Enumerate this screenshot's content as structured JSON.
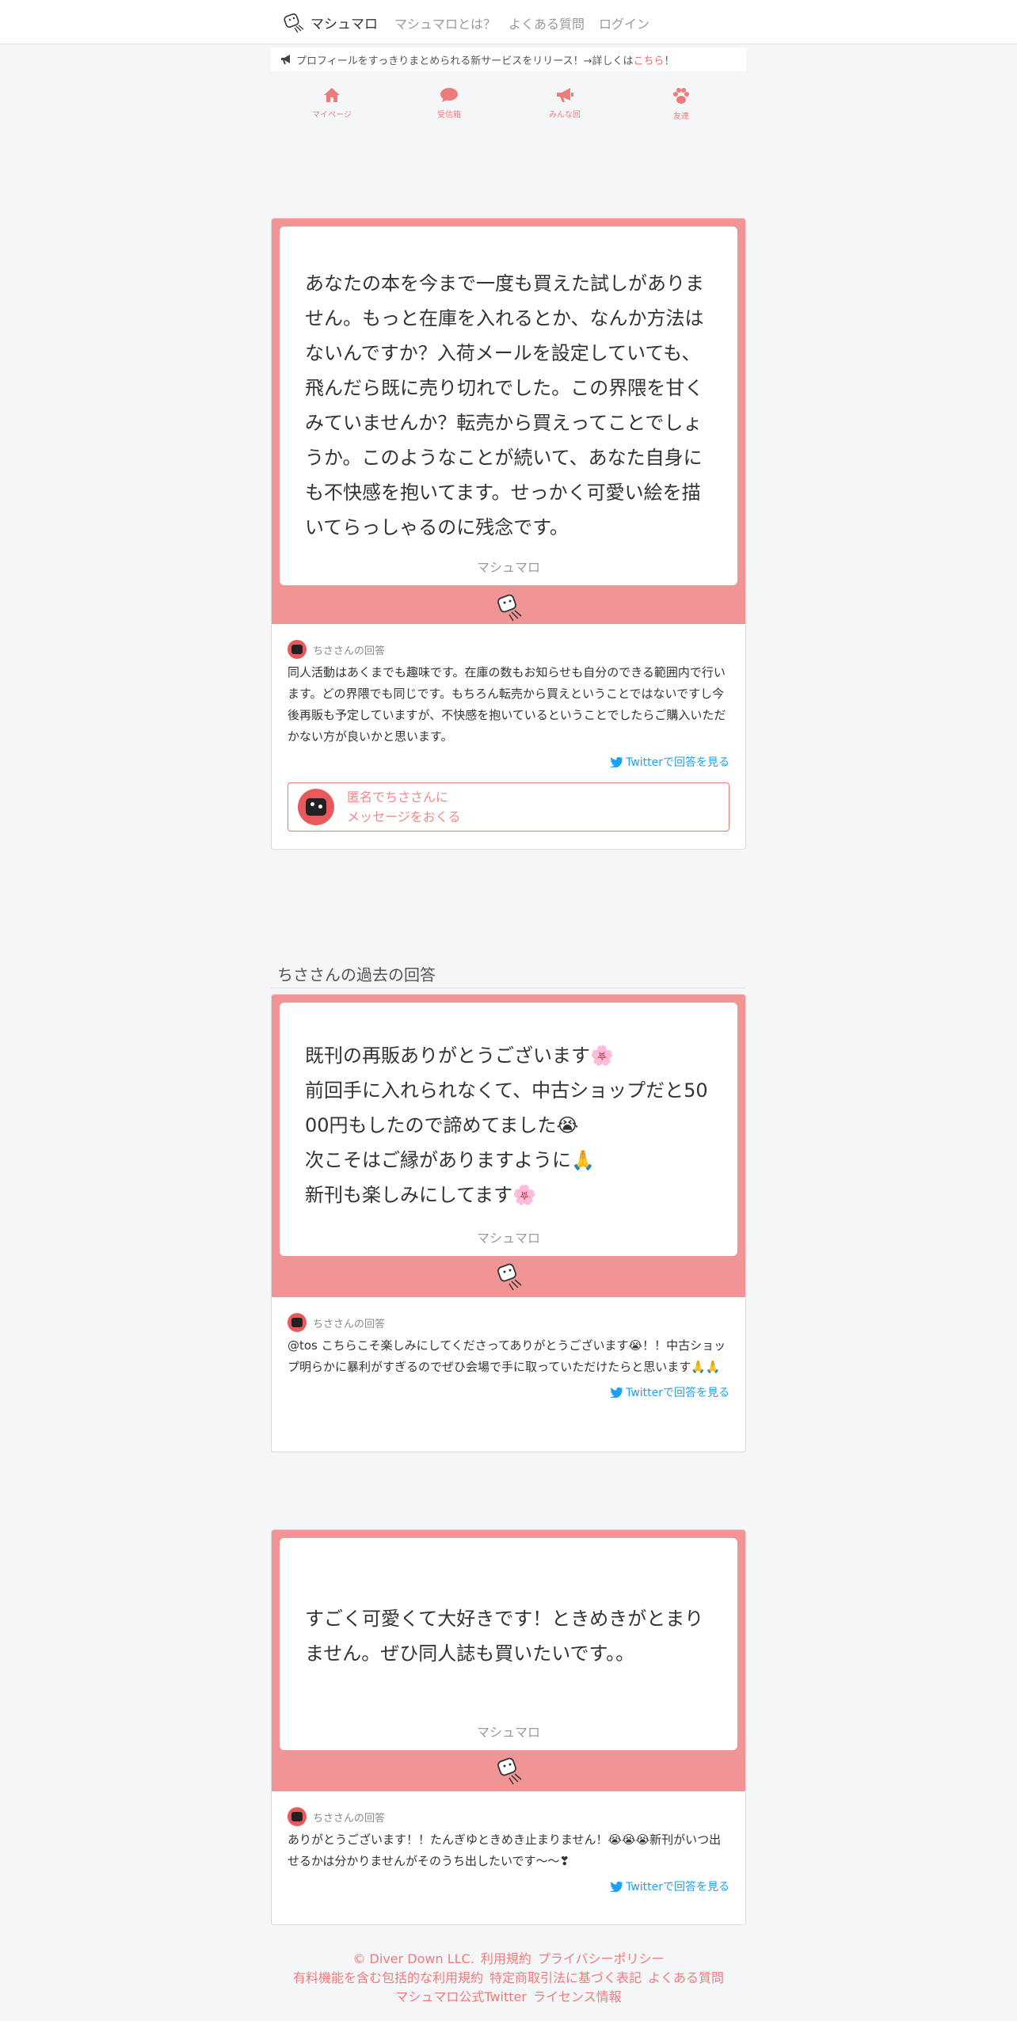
{
  "nav": {
    "brand": "マシュマロ",
    "links": [
      "マシュマロとは？",
      "よくある質問",
      "ログイン"
    ]
  },
  "announcement": {
    "text": "プロフィールをすっきりまとめられる新サービスをリリース！→詳しくは",
    "link": "こちら",
    "suffix": "！"
  },
  "tabs": [
    {
      "label": "マイページ",
      "icon": "home-icon"
    },
    {
      "label": "受信箱",
      "icon": "comment-icon"
    },
    {
      "label": "みんな回",
      "icon": "bullhorn-icon"
    },
    {
      "label": "友達",
      "icon": "paw-icon"
    }
  ],
  "main": {
    "marshmallow_text": "あなたの本を今まで一度も買えた試しがありません。もっと在庫を入れるとか、なんか方法はないんですか？入荷メールを設定していても、飛んだら既に売り切れでした。この界隈を甘くみていませんか？転売から買えってことでしょうか。このようなことが続いて、あなた自身にも不快感を抱いてます。せっかく可愛い絵を描いてらっしゃるのに残念です。",
    "marshmallow_brand": "マシュマロ",
    "answer_head": "ちささんの回答",
    "answer_text": "同人活動はあくまでも趣味です。在庫の数もお知らせも自分のできる範囲内で行います。どの界隈でも同じです。もちろん転売から買えということではないですし今後再販も予定していますが、不快感を抱いているということでしたらご購入いただかない方が良いかと思います。",
    "twitter_label": "Twitterで回答を見る",
    "send_line1": "匿名でちささんに",
    "send_line2": "メッセージをおくる"
  },
  "past_title": "ちささんの過去の回答",
  "past": [
    {
      "lines": [
        "既刊の再販ありがとうございます&#x1F338;",
        "前回手に入れられなくて、中古ショップだと5000円もしたので諦めてました&#x1F62D;",
        "次こそはご縁がありますように&#x1F64F;",
        "新刊も楽しみにしてます&#x1F338;"
      ],
      "brand": "マシュマロ",
      "answer_head": "ちささんの回答",
      "answer_text": "@tos こちらこそ楽しみにしてくださってありがとうございます&#x1F62D;！！中古ショップ明らかに暴利がすぎるのでぜひ会場で手に取っていただけたらと思います&#x1F64F;&#x1F64F;",
      "twitter_label": "Twitterで回答を見る"
    },
    {
      "lines": [
        "すごく可愛くて大好きです！ときめきがとまりません。ぜひ同人誌も買いたいです。。"
      ],
      "brand": "マシュマロ",
      "answer_head": "ちささんの回答",
      "answer_text": "ありがとうございます！！たんぎゆときめき止まりません！&#x1F62D;&#x1F62D;&#x1F62D;新刊がいつ出せるかは分かりませんがそのうち出したいです〜〜&#x2763;",
      "twitter_label": "Twitterで回答を見る"
    }
  ],
  "footer": {
    "row1": [
      "© Diver Down LLC.",
      "利用規約",
      "プライバシーポリシー"
    ],
    "row2": [
      "有料機能を含む包括的な利用規約",
      "特定商取引法に基づく表記",
      "よくある質問"
    ],
    "row3": [
      "マシュマロ公式Twitter",
      "ライセンス情報"
    ]
  },
  "colors": {
    "accent": "#f19496",
    "link": "#ea6b6b",
    "twitter": "#1da1f2"
  }
}
